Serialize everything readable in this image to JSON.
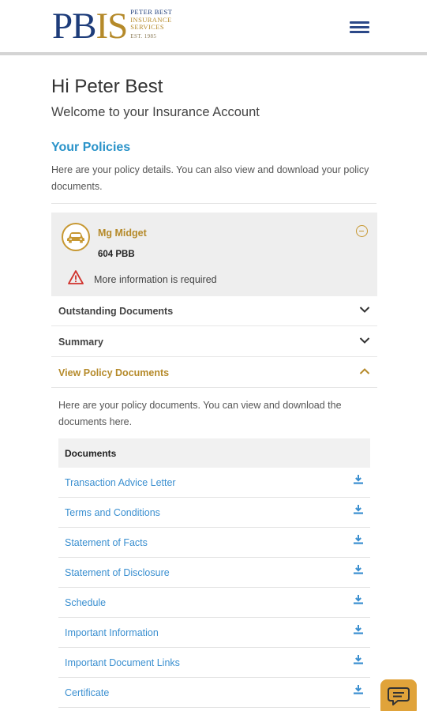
{
  "header": {
    "logo_mark_left": "PB",
    "logo_mark_right": "IS",
    "logo_line1": "PETER BEST",
    "logo_line2": "INSURANCE",
    "logo_line3": "SERVICES",
    "logo_line4": "EST. 1985",
    "menu_icon": "hamburger-menu-icon"
  },
  "greeting": "Hi Peter Best",
  "welcome": "Welcome to your Insurance Account",
  "policies": {
    "title": "Your Policies",
    "description": "Here are your policy details. You can also view and download your policy documents."
  },
  "policy": {
    "name": "Mg Midget",
    "registration": "604 PBB",
    "warning": "More information is required",
    "icon": "car-icon",
    "collapse_icon": "minus-circle-icon"
  },
  "accordion": [
    {
      "label": "Outstanding Documents",
      "state": "collapsed"
    },
    {
      "label": "Summary",
      "state": "collapsed"
    },
    {
      "label": "View Policy Documents",
      "state": "expanded"
    }
  ],
  "documents": {
    "intro": "Here are your policy documents. You can view and download the documents here.",
    "header": "Documents",
    "items": [
      "Transaction Advice Letter",
      "Terms and Conditions",
      "Statement of Facts",
      "Statement of Disclosure",
      "Schedule",
      "Important Information",
      "Important Document Links",
      "Certificate"
    ]
  },
  "colors": {
    "brand_navy": "#1d3c7a",
    "brand_gold": "#b58a2a",
    "link_blue": "#3a8fd0",
    "heading_blue": "#2a93c9",
    "warning_red": "#d0322c",
    "chat_orange": "#e0a33a"
  }
}
